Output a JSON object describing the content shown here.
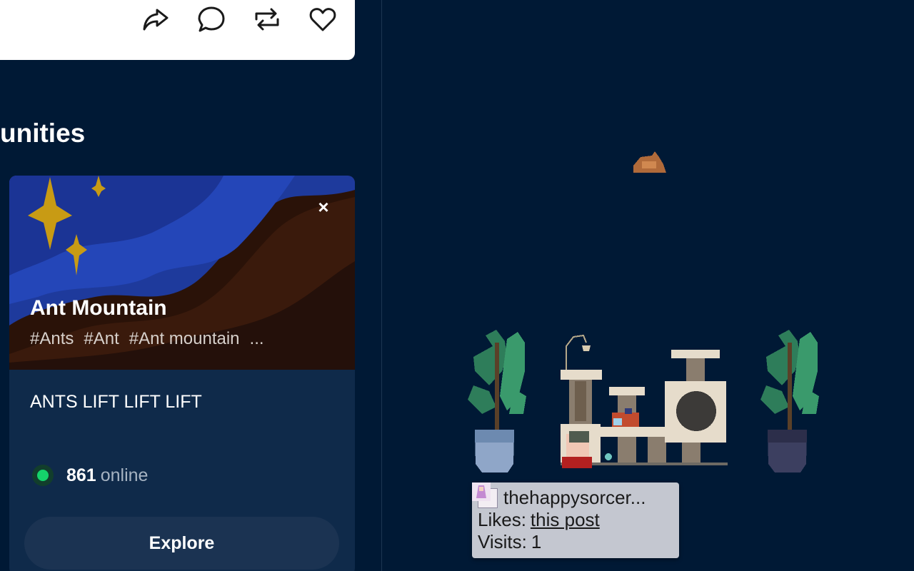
{
  "post_actions": {
    "share_icon": "share-icon",
    "comment_icon": "comment-icon",
    "reblog_icon": "reblog-icon",
    "like_icon": "heart-icon"
  },
  "communities_section": {
    "title": "unities"
  },
  "community_card": {
    "name": "Ant Mountain",
    "tags": [
      "#Ants",
      "#Ant",
      "#Ant mountain",
      "..."
    ],
    "description": "ANTS LIFT LIFT LIFT",
    "online_count": "861",
    "online_label": "online",
    "explore_label": "Explore",
    "close_label": "×",
    "colors": {
      "online": "#15d36b",
      "button": "#1b3352"
    }
  },
  "tooltip": {
    "username": "thehappysorcer...",
    "likes_label": "Likes:",
    "likes_link": "this post",
    "visits_label": "Visits:",
    "visits_value": "1"
  },
  "colors": {
    "background": "#001935",
    "card": "#0f2a4a"
  }
}
